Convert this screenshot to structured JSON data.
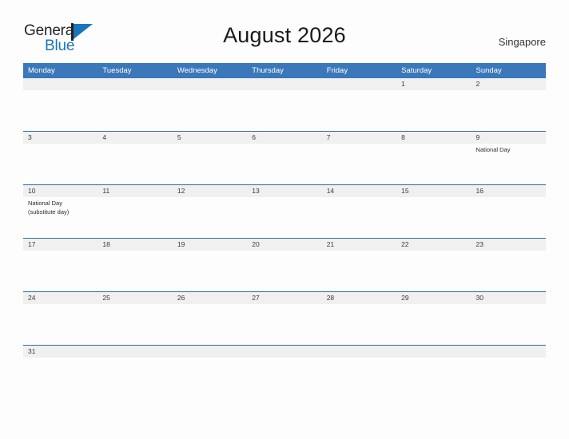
{
  "brand": {
    "word_one": "General",
    "word_two": "Blue",
    "mark_icon": "flag-triangle-icon",
    "color_dark": "#231f20",
    "color_blue": "#1b75bb"
  },
  "header": {
    "title": "August 2026",
    "region": "Singapore"
  },
  "theme": {
    "header_blue": "#3a78ba",
    "rule_blue": "#2e6da4",
    "number_band_gray": "#f0f0f0",
    "page_background": "#fdfdfd",
    "text_dark": "#1a1a1a"
  },
  "calendar": {
    "day_headers": [
      "Monday",
      "Tuesday",
      "Wednesday",
      "Thursday",
      "Friday",
      "Saturday",
      "Sunday"
    ],
    "weeks": [
      [
        {
          "day": "",
          "events": []
        },
        {
          "day": "",
          "events": []
        },
        {
          "day": "",
          "events": []
        },
        {
          "day": "",
          "events": []
        },
        {
          "day": "",
          "events": []
        },
        {
          "day": "1",
          "events": []
        },
        {
          "day": "2",
          "events": []
        }
      ],
      [
        {
          "day": "3",
          "events": []
        },
        {
          "day": "4",
          "events": []
        },
        {
          "day": "5",
          "events": []
        },
        {
          "day": "6",
          "events": []
        },
        {
          "day": "7",
          "events": []
        },
        {
          "day": "8",
          "events": []
        },
        {
          "day": "9",
          "events": [
            "National Day"
          ]
        }
      ],
      [
        {
          "day": "10",
          "events": [
            "National Day",
            "(substitute day)"
          ]
        },
        {
          "day": "11",
          "events": []
        },
        {
          "day": "12",
          "events": []
        },
        {
          "day": "13",
          "events": []
        },
        {
          "day": "14",
          "events": []
        },
        {
          "day": "15",
          "events": []
        },
        {
          "day": "16",
          "events": []
        }
      ],
      [
        {
          "day": "17",
          "events": []
        },
        {
          "day": "18",
          "events": []
        },
        {
          "day": "19",
          "events": []
        },
        {
          "day": "20",
          "events": []
        },
        {
          "day": "21",
          "events": []
        },
        {
          "day": "22",
          "events": []
        },
        {
          "day": "23",
          "events": []
        }
      ],
      [
        {
          "day": "24",
          "events": []
        },
        {
          "day": "25",
          "events": []
        },
        {
          "day": "26",
          "events": []
        },
        {
          "day": "27",
          "events": []
        },
        {
          "day": "28",
          "events": []
        },
        {
          "day": "29",
          "events": []
        },
        {
          "day": "30",
          "events": []
        }
      ],
      [
        {
          "day": "31",
          "events": []
        },
        {
          "day": "",
          "events": []
        },
        {
          "day": "",
          "events": []
        },
        {
          "day": "",
          "events": []
        },
        {
          "day": "",
          "events": []
        },
        {
          "day": "",
          "events": []
        },
        {
          "day": "",
          "events": []
        }
      ]
    ]
  }
}
